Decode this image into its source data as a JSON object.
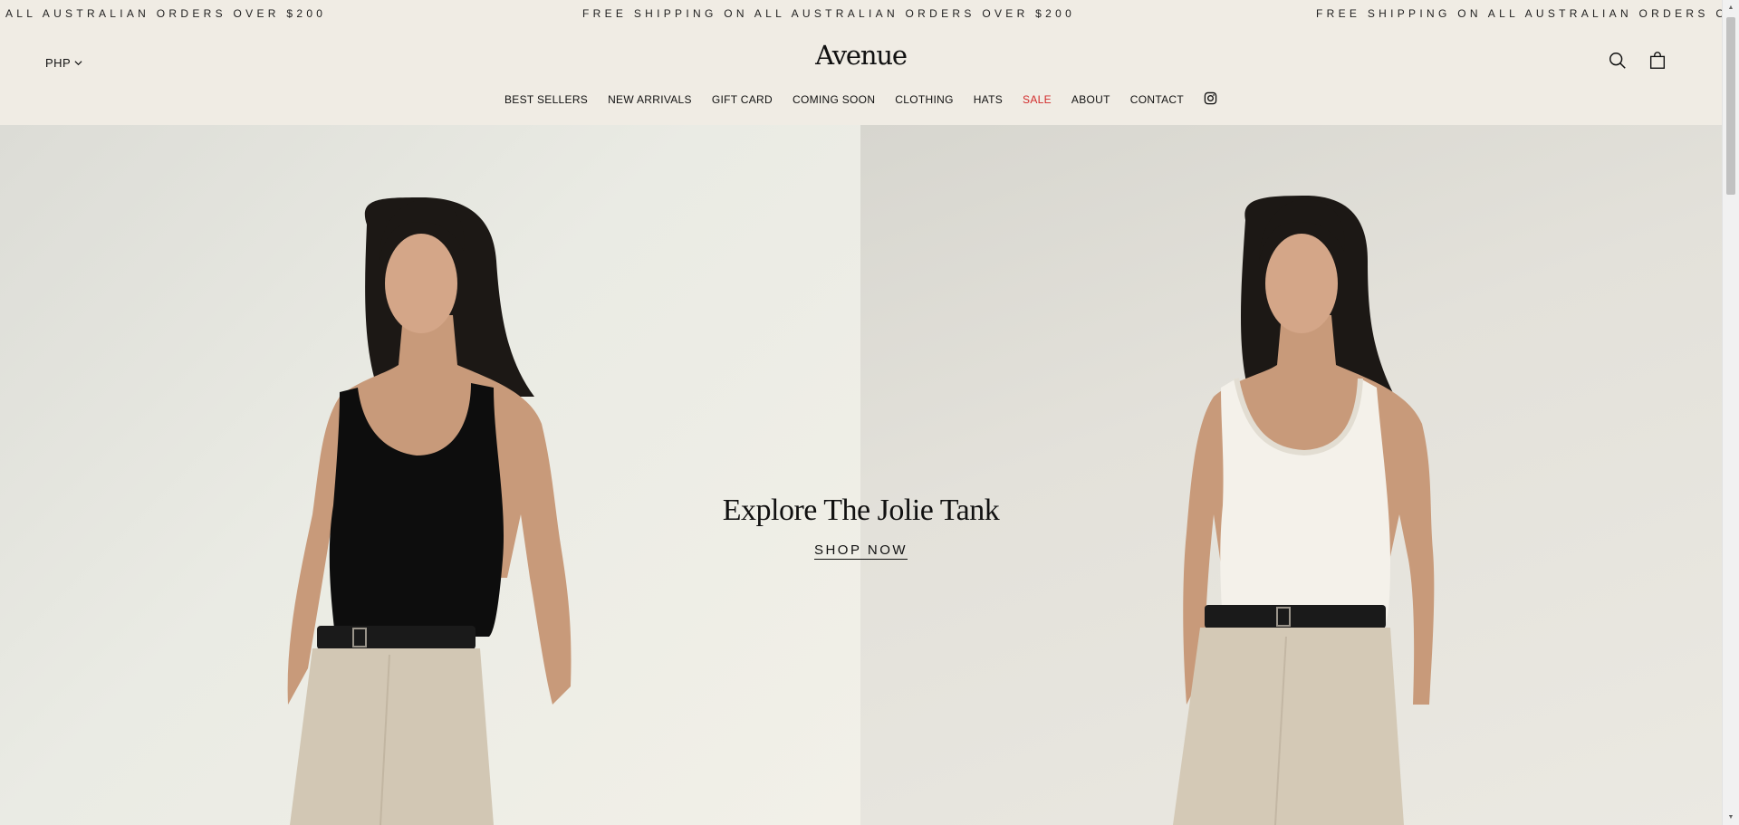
{
  "announcement": {
    "left_text": "ALL AUSTRALIAN ORDERS OVER $200",
    "center_text": "FREE SHIPPING ON ALL AUSTRALIAN ORDERS OVER $200",
    "right_text": "FREE SHIPPING ON ALL AUSTRALIAN ORDERS OVER"
  },
  "header": {
    "currency": "PHP",
    "logo": "Avenue",
    "icons": [
      "search-icon",
      "cart-icon"
    ]
  },
  "nav": {
    "items": [
      {
        "label": "BEST SELLERS"
      },
      {
        "label": "NEW ARRIVALS"
      },
      {
        "label": "GIFT CARD"
      },
      {
        "label": "COMING SOON"
      },
      {
        "label": "CLOTHING"
      },
      {
        "label": "HATS"
      },
      {
        "label": "SALE",
        "color": "#d22b2b"
      },
      {
        "label": "ABOUT"
      },
      {
        "label": "CONTACT"
      }
    ],
    "social_icon": "instagram-icon"
  },
  "hero": {
    "title": "Explore  The Jolie Tank",
    "cta": "SHOP NOW",
    "images": [
      {
        "name": "model-black-tank",
        "top_color": "#0d0d0d",
        "pants_color": "#d2c7b4"
      },
      {
        "name": "model-white-tank",
        "top_color": "#f4f1ea",
        "pants_color": "#d4c9b6"
      }
    ]
  },
  "colors": {
    "background": "#f0ece4",
    "text": "#111111",
    "sale": "#d22b2b"
  }
}
